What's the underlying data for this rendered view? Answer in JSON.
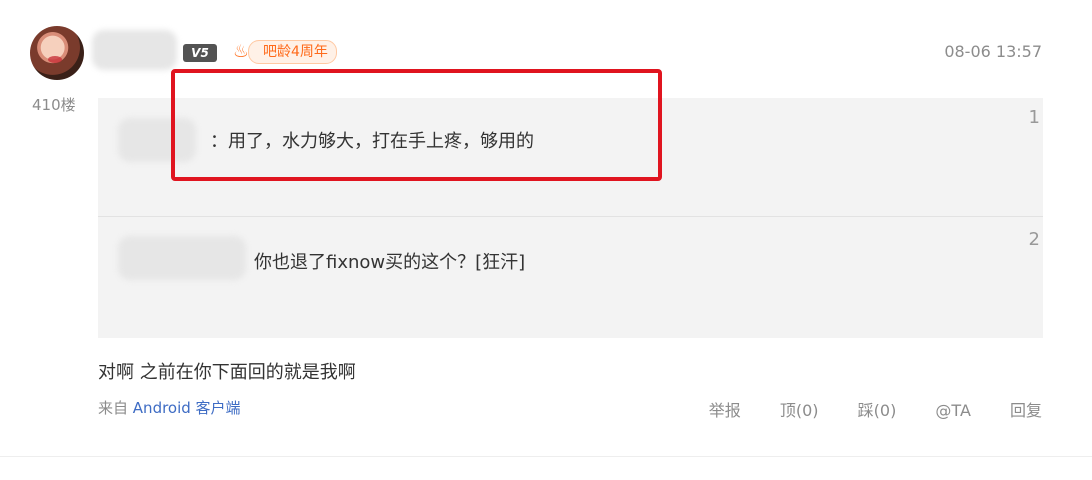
{
  "comment": {
    "floor": "410楼",
    "date": "08-06 13:57",
    "level_badge": "V5",
    "anniversary_badge": "吧龄4周年",
    "text": "对啊 之前在你下面回的就是我啊",
    "source_prefix": "来自",
    "source_client": "Android 客户端"
  },
  "replies": [
    {
      "text": "：用了，水力够大，打在手上疼，够用的",
      "number": "1"
    },
    {
      "text": "你也退了fixnow买的这个？[狂汗]",
      "number": "2"
    }
  ],
  "actions": {
    "report": "举报",
    "upvote": "顶(0)",
    "downvote": "踩(0)",
    "mention": "@TA",
    "reply": "回复"
  },
  "colors": {
    "highlight": "#e0141f",
    "link": "#3e6cc4",
    "badge": "#ff6a1a"
  }
}
